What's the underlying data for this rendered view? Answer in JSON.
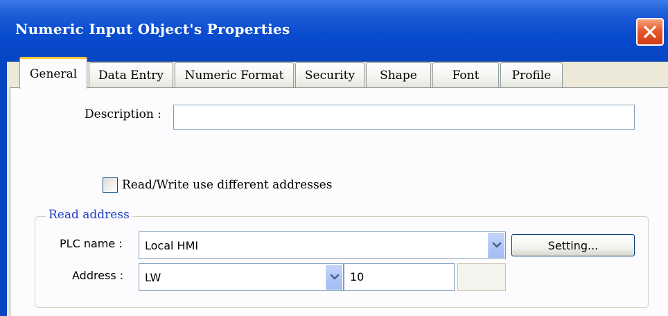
{
  "window": {
    "title": "Numeric Input Object's Properties"
  },
  "tabs": [
    {
      "label": "General",
      "active": true
    },
    {
      "label": "Data Entry",
      "active": false
    },
    {
      "label": "Numeric Format",
      "active": false
    },
    {
      "label": "Security",
      "active": false
    },
    {
      "label": "Shape",
      "active": false
    },
    {
      "label": "Font",
      "active": false
    },
    {
      "label": "Profile",
      "active": false
    }
  ],
  "general": {
    "description_label": "Description :",
    "description_value": "",
    "rw_checkbox_label": "Read/Write use different addresses",
    "rw_checkbox_checked": false
  },
  "read_address": {
    "group_title": "Read address",
    "plc_name_label": "PLC name :",
    "plc_name_value": "Local HMI",
    "setting_button": "Setting...",
    "address_label": "Address :",
    "address_type_value": "LW",
    "address_number_value": "10",
    "address_extra_value": ""
  },
  "icons": {
    "close": "close-icon",
    "dropdown": "chevron-down-icon"
  },
  "colors": {
    "titlebar": "#0a4ccf",
    "close_button": "#e65a2c",
    "active_tab_highlight": "#ffc83c",
    "group_title": "#1d3ec1"
  }
}
